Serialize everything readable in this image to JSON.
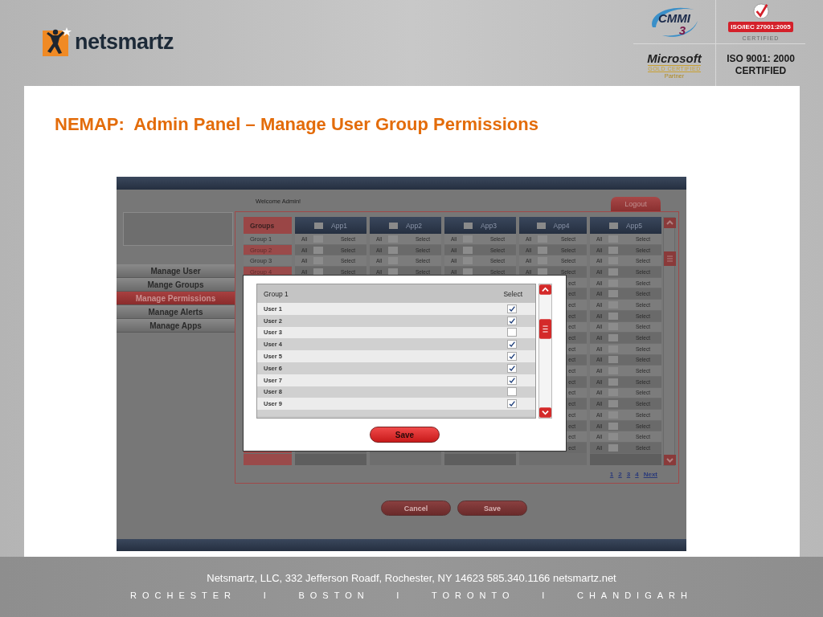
{
  "header": {
    "logo": {
      "text": "netsmartz"
    },
    "certifications": {
      "cmmi": {
        "name": "CMMI",
        "level": "3"
      },
      "iso27001": {
        "badge": "ISO/IEC 27001:2005",
        "caption": "CERTIFIED"
      },
      "microsoft": {
        "name": "Microsoft",
        "caption": "GOLD CERTIFIED",
        "sub": "Partner"
      },
      "iso9001": {
        "line1": "ISO 9001: 2000",
        "line2": "CERTIFIED"
      }
    }
  },
  "title": "NEMAP:  Admin Panel – Manage User Group Permissions",
  "mockup": {
    "welcome": "Welcome Admin!",
    "logout": "Logout",
    "menu": [
      {
        "label": "Manage User",
        "selected": false
      },
      {
        "label": "Mange Groups",
        "selected": false
      },
      {
        "label": "Manage Permissions",
        "selected": true
      },
      {
        "label": "Manage Alerts",
        "selected": false
      },
      {
        "label": "Manage Apps",
        "selected": false
      }
    ],
    "table": {
      "groups_header": "Groups",
      "apps": [
        {
          "name": "App1",
          "checked": false
        },
        {
          "name": "App2",
          "checked": false
        },
        {
          "name": "App3",
          "checked": false
        },
        {
          "name": "App4",
          "checked": false
        },
        {
          "name": "App5",
          "checked": false
        }
      ],
      "rows": [
        {
          "group": "Group 1",
          "cells": [
            {
              "all": "All",
              "checked": false,
              "select": "Select"
            },
            {
              "all": "All",
              "checked": false,
              "select": "Select"
            },
            {
              "all": "All",
              "checked": false,
              "select": "Select"
            },
            {
              "all": "All",
              "checked": false,
              "select": "Select"
            },
            {
              "all": "All",
              "checked": false,
              "select": "Select"
            }
          ]
        },
        {
          "group": "Group 2",
          "cells": [
            {
              "all": "All",
              "checked": false,
              "select": "Select"
            },
            {
              "all": "All",
              "checked": false,
              "select": "Select"
            },
            {
              "all": "All",
              "checked": false,
              "select": "Select"
            },
            {
              "all": "All",
              "checked": false,
              "select": "Select"
            },
            {
              "all": "All",
              "checked": false,
              "select": "Select"
            }
          ]
        },
        {
          "group": "Group 3",
          "cells": [
            {
              "all": "All",
              "checked": false,
              "select": "Select"
            },
            {
              "all": "All",
              "checked": false,
              "select": "Select"
            },
            {
              "all": "All",
              "checked": false,
              "select": "Select"
            },
            {
              "all": "All",
              "checked": false,
              "select": "Select"
            },
            {
              "all": "All",
              "checked": false,
              "select": "Select"
            }
          ]
        },
        {
          "group": "Group 4",
          "cells": [
            {
              "all": "All",
              "checked": false,
              "select": "Select"
            },
            {
              "all": "All",
              "checked": false,
              "select": "Select"
            },
            {
              "all": "All",
              "checked": false,
              "select": "Select"
            },
            {
              "all": "All",
              "checked": false,
              "select": "Select"
            },
            {
              "all": "All",
              "checked": false,
              "select": "Select"
            }
          ]
        },
        {
          "cells": [
            {},
            {},
            {},
            {
              "select": "ect"
            },
            {
              "all": "All",
              "checked": false,
              "select": "Select"
            }
          ]
        },
        {
          "cells": [
            {},
            {},
            {},
            {
              "select": "ect"
            },
            {
              "all": "All",
              "checked": false,
              "select": "Select"
            }
          ]
        },
        {
          "cells": [
            {},
            {},
            {},
            {
              "select": "ect"
            },
            {
              "all": "All",
              "checked": false,
              "select": "Select"
            }
          ]
        },
        {
          "cells": [
            {},
            {},
            {},
            {
              "select": "ect"
            },
            {
              "all": "All",
              "checked": false,
              "select": "Select"
            }
          ]
        },
        {
          "cells": [
            {},
            {},
            {},
            {
              "select": "ect"
            },
            {
              "all": "All",
              "checked": false,
              "select": "Select"
            }
          ]
        },
        {
          "cells": [
            {},
            {},
            {},
            {
              "select": "ect"
            },
            {
              "all": "All",
              "checked": false,
              "select": "Select"
            }
          ]
        },
        {
          "cells": [
            {},
            {},
            {},
            {
              "select": "ect"
            },
            {
              "all": "All",
              "checked": false,
              "select": "Select"
            }
          ]
        },
        {
          "cells": [
            {},
            {},
            {},
            {
              "select": "ect"
            },
            {
              "all": "All",
              "checked": false,
              "select": "Select"
            }
          ]
        },
        {
          "cells": [
            {},
            {},
            {},
            {
              "select": "ect"
            },
            {
              "all": "All",
              "checked": false,
              "select": "Select"
            }
          ]
        },
        {
          "cells": [
            {},
            {},
            {},
            {
              "select": "ect"
            },
            {
              "all": "All",
              "checked": false,
              "select": "Select"
            }
          ]
        },
        {
          "cells": [
            {},
            {},
            {},
            {
              "select": "ect"
            },
            {
              "all": "All",
              "checked": false,
              "select": "Select"
            }
          ]
        },
        {
          "cells": [
            {},
            {},
            {},
            {
              "select": "ect"
            },
            {
              "all": "All",
              "checked": false,
              "select": "Select"
            }
          ]
        },
        {
          "cells": [
            {},
            {},
            {},
            {
              "select": "ect"
            },
            {
              "all": "All",
              "checked": false,
              "select": "Select"
            }
          ]
        },
        {
          "cells": [
            {},
            {},
            {},
            {
              "select": "ect"
            },
            {
              "all": "All",
              "checked": false,
              "select": "Select"
            }
          ]
        },
        {
          "cells": [
            {},
            {},
            {},
            {
              "select": "ect"
            },
            {
              "all": "All",
              "checked": false,
              "select": "Select"
            }
          ]
        },
        {
          "cells": [
            {},
            {},
            {},
            {
              "select": "ect"
            },
            {
              "all": "All",
              "checked": false,
              "select": "Select"
            }
          ]
        }
      ]
    },
    "pagination": [
      "1",
      "2",
      "3",
      "4",
      "Next"
    ],
    "buttons": [
      "Cancel",
      "Save"
    ],
    "dialog": {
      "header": "Group 1",
      "select_header": "Select",
      "users": [
        {
          "name": "User 1",
          "checked": true
        },
        {
          "name": "User 2",
          "checked": true
        },
        {
          "name": "User 3",
          "checked": false
        },
        {
          "name": "User 4",
          "checked": true
        },
        {
          "name": "User 5",
          "checked": true
        },
        {
          "name": "User 6",
          "checked": true
        },
        {
          "name": "User 7",
          "checked": true
        },
        {
          "name": "User 8",
          "checked": false
        },
        {
          "name": "User 9",
          "checked": true
        }
      ],
      "save": "Save"
    }
  },
  "footer": {
    "address": "Netsmartz, LLC, 332 Jefferson Roadf, Rochester, NY 14623 585.340.1166 netsmartz.net",
    "cities": [
      "ROCHESTER",
      "I",
      "BOSTON",
      "I",
      "TORONTO",
      "I",
      "CHANDIGARH"
    ]
  }
}
